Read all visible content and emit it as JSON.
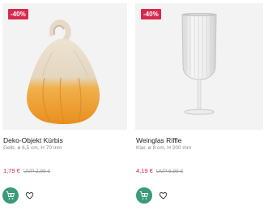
{
  "products": [
    {
      "badge": "-40%",
      "name": "Deko-Objekt Kürbis",
      "desc": "Gelb, ø 6,5 cm, H 70 mm",
      "price": "1,79 €",
      "old_price": "UVP 2,99 €",
      "image_icon": "pumpkin-figurine",
      "colors": {
        "top": "#e9e0cf",
        "bottom": "#ee9a2a"
      }
    },
    {
      "badge": "-40%",
      "name": "Weinglas Riffle",
      "desc": "Klar, ø 8 cm, H 200 mm",
      "price": "4,19 €",
      "old_price": "UVP 6,99 €",
      "image_icon": "wine-glass",
      "colors": {
        "glass": "#e6e6e6"
      }
    }
  ],
  "colors": {
    "accent": "#d9284e",
    "cart": "#3a9a7a"
  },
  "icons": {
    "cart": "cart-plus-icon",
    "wishlist": "heart-icon"
  }
}
